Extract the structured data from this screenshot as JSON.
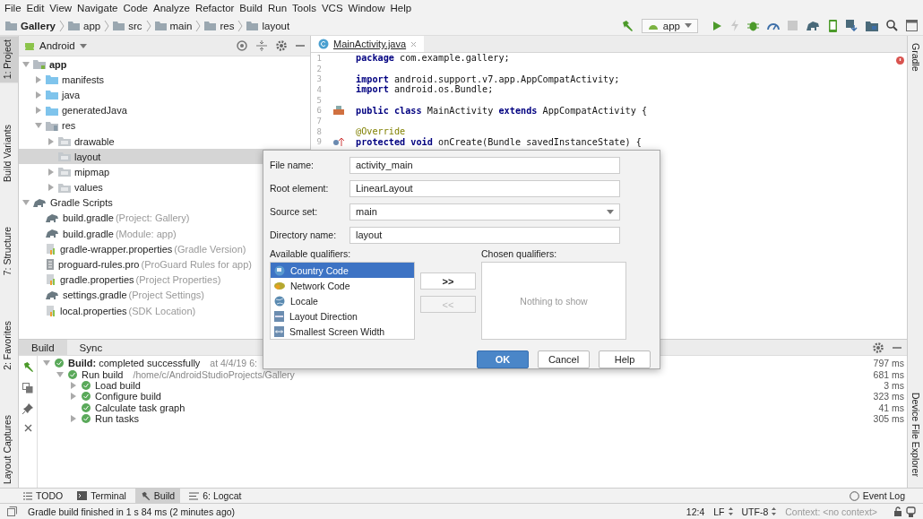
{
  "menu": [
    "File",
    "Edit",
    "View",
    "Navigate",
    "Code",
    "Analyze",
    "Refactor",
    "Build",
    "Run",
    "Tools",
    "VCS",
    "Window",
    "Help"
  ],
  "breadcrumb": [
    "Gallery",
    "app",
    "src",
    "main",
    "res",
    "layout"
  ],
  "run_config": "app",
  "left_tool_tabs": [
    {
      "label": "1: Project",
      "selected": true
    },
    {
      "label": "Build Variants",
      "selected": false
    },
    {
      "label": "7: Structure",
      "selected": false
    },
    {
      "label": "2: Favorites",
      "selected": false
    },
    {
      "label": "Layout Captures",
      "selected": false
    }
  ],
  "right_tool_tabs": [
    {
      "label": "Gradle"
    },
    {
      "label": "Device File Explorer"
    }
  ],
  "project": {
    "view": "Android",
    "tree": [
      {
        "label": "app",
        "kind": "module",
        "expanded": true,
        "selected": false,
        "children": [
          {
            "label": "manifests",
            "kind": "folder",
            "expanded": false,
            "selected": false
          },
          {
            "label": "java",
            "kind": "folder",
            "expanded": false,
            "selected": false
          },
          {
            "label": "generatedJava",
            "kind": "folder",
            "expanded": false,
            "selected": false
          },
          {
            "label": "res",
            "kind": "resfolder",
            "expanded": true,
            "selected": false,
            "children": [
              {
                "label": "drawable",
                "kind": "plainfolder",
                "expanded": false,
                "selected": false
              },
              {
                "label": "layout",
                "kind": "plainfolder",
                "selected": true
              },
              {
                "label": "mipmap",
                "kind": "plainfolder",
                "expanded": false,
                "selected": false
              },
              {
                "label": "values",
                "kind": "plainfolder",
                "expanded": false,
                "selected": false
              }
            ]
          }
        ]
      },
      {
        "label": "Gradle Scripts",
        "kind": "gradle",
        "expanded": true,
        "selected": false,
        "children": [
          {
            "label": "build.gradle",
            "note": "(Project: Gallery)",
            "kind": "gradle",
            "selected": false
          },
          {
            "label": "build.gradle",
            "note": "(Module: app)",
            "kind": "gradle",
            "selected": false
          },
          {
            "label": "gradle-wrapper.properties",
            "note": "(Gradle Version)",
            "kind": "properties",
            "selected": false
          },
          {
            "label": "proguard-rules.pro",
            "note": "(ProGuard Rules for app)",
            "kind": "file",
            "selected": false
          },
          {
            "label": "gradle.properties",
            "note": "(Project Properties)",
            "kind": "properties",
            "selected": false
          },
          {
            "label": "settings.gradle",
            "note": "(Project Settings)",
            "kind": "gradle",
            "selected": false
          },
          {
            "label": "local.properties",
            "note": "(SDK Location)",
            "kind": "properties",
            "selected": false
          }
        ]
      }
    ]
  },
  "editor": {
    "tab": "MainActivity.java",
    "lines": [
      {
        "number": "1",
        "code": "**package** com.example.gallery;",
        "kind": "code"
      },
      {
        "number": "2",
        "kind": "blank"
      },
      {
        "number": "3",
        "code": "**import** android.support.v7.app.AppCompatActivity;",
        "kind": "code"
      },
      {
        "number": "4",
        "code": "**import** android.os.Bundle;",
        "kind": "code"
      },
      {
        "number": "5",
        "kind": "blank"
      },
      {
        "number": "6",
        "code": "**public class** MainActivity **extends** AppCompatActivity {",
        "kind": "class_declaration"
      },
      {
        "number": "7",
        "kind": "blank"
      },
      {
        "number": "8",
        "code": "@Override",
        "kind": "annotation"
      },
      {
        "number": "9",
        "code": "**protected void** onCreate(Bundle savedInstanceState) {",
        "kind": "method"
      }
    ]
  },
  "build": {
    "tabs": [
      {
        "label": "Build",
        "selected": true
      },
      {
        "label": "Sync",
        "selected": false
      }
    ],
    "rows": [
      {
        "label": "**Build:** completed successfully",
        "detail": "at 4/4/19 6:",
        "time": "797 ms",
        "expanded": true,
        "children": [
          {
            "label": "Run build",
            "detail": "/home/c/AndroidStudioProjects/Gallery",
            "time": "681 ms",
            "expanded": true,
            "children": [
              {
                "label": "Load build",
                "time": "3 ms",
                "expanded": false
              },
              {
                "label": "Configure build",
                "time": "323 ms",
                "expanded": false
              },
              {
                "label": "Calculate task graph",
                "time": "41 ms"
              },
              {
                "label": "Run tasks",
                "time": "305 ms",
                "expanded": false
              }
            ]
          }
        ]
      }
    ]
  },
  "dialog": {
    "fields": [
      {
        "label": "File name:",
        "value": "activity_main",
        "kind": "text"
      },
      {
        "label": "Root element:",
        "value": "LinearLayout",
        "kind": "text"
      },
      {
        "label": "Source set:",
        "value": "main",
        "kind": "dropdown"
      },
      {
        "label": "Directory name:",
        "value": "layout",
        "kind": "text"
      }
    ],
    "available_label": "Available qualifiers:",
    "qualifiers": [
      {
        "label": "Country Code",
        "kind": "country",
        "selected": true
      },
      {
        "label": "Network Code",
        "kind": "network",
        "selected": false
      },
      {
        "label": "Locale",
        "kind": "locale",
        "selected": false
      },
      {
        "label": "Layout Direction",
        "kind": "direction",
        "selected": false
      },
      {
        "label": "Smallest Screen Width",
        "kind": "width",
        "selected": false
      }
    ],
    "move_buttons": [
      {
        "label": ">>",
        "disabled": false
      },
      {
        "label": "<<",
        "disabled": true
      }
    ],
    "chosen_label": "Chosen qualifiers:",
    "chosen_empty": "Nothing to show",
    "buttons": [
      {
        "label": "OK",
        "kind": "default"
      },
      {
        "label": "Cancel",
        "kind": "normal"
      },
      {
        "label": "Help",
        "kind": "normal"
      }
    ]
  },
  "tool_windows": [
    {
      "label": "TODO",
      "kind": "list",
      "selected": false
    },
    {
      "label": "Terminal",
      "kind": "terminal",
      "selected": false
    },
    {
      "label": "Build",
      "kind": "build",
      "selected": true
    },
    {
      "label": "6: Logcat",
      "kind": "logcat",
      "selected": false
    }
  ],
  "event_log": "Event Log",
  "status_bar": {
    "message": "Gradle build finished in 1 s 84 ms (2 minutes ago)",
    "position": "12:4",
    "line_separator": "LF",
    "encoding": "UTF-8",
    "context": "Context: <no context>"
  }
}
